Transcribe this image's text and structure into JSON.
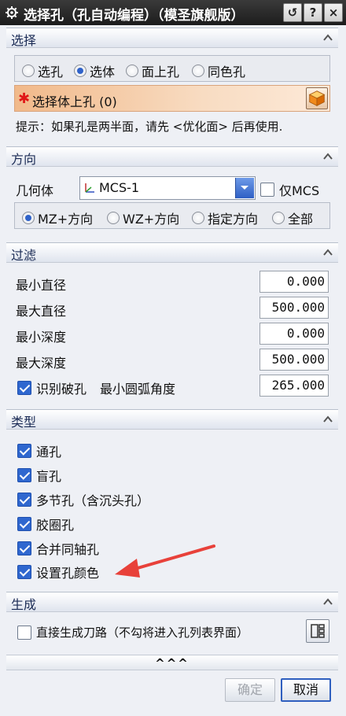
{
  "window": {
    "title": "选择孔（孔自动编程）（模圣旗舰版）",
    "title_buttons": [
      {
        "icon": "undo-icon",
        "label": "↺"
      },
      {
        "icon": "help-icon",
        "label": "?"
      },
      {
        "icon": "close-icon",
        "label": "×"
      }
    ]
  },
  "select_section": {
    "title": "选择",
    "modes": [
      {
        "label": "选孔",
        "selected": false
      },
      {
        "label": "选体",
        "selected": true
      },
      {
        "label": "面上孔",
        "selected": false
      },
      {
        "label": "同色孔",
        "selected": false
      }
    ],
    "select_label": "选择体上孔 (0)",
    "hint": "提示：如果孔是两半面，请先 <优化面> 后再使用."
  },
  "direction_section": {
    "title": "方向",
    "geometry_label": "几何体",
    "geometry_value": "MCS-1",
    "only_mcs_label": "仅MCS",
    "only_mcs_checked": false,
    "directions": [
      {
        "label": "MZ+方向",
        "selected": true
      },
      {
        "label": "WZ+方向",
        "selected": false
      },
      {
        "label": "指定方向",
        "selected": false
      },
      {
        "label": "全部",
        "selected": false
      }
    ]
  },
  "filter_section": {
    "title": "过滤",
    "min_diameter_label": "最小直径",
    "min_diameter": "0.000",
    "max_diameter_label": "最大直径",
    "max_diameter": "500.000",
    "min_depth_label": "最小深度",
    "min_depth": "0.000",
    "max_depth_label": "最大深度",
    "max_depth": "500.000",
    "broken_hole_label": "识别破孔",
    "broken_hole_checked": true,
    "min_arc_angle_label": "最小圆弧角度",
    "min_arc_angle": "265.000"
  },
  "type_section": {
    "title": "类型",
    "items": [
      {
        "label": "通孔",
        "checked": true
      },
      {
        "label": "盲孔",
        "checked": true
      },
      {
        "label": "多节孔（含沉头孔）",
        "checked": true
      },
      {
        "label": "胶圈孔",
        "checked": true
      },
      {
        "label": "合并同轴孔",
        "checked": true
      },
      {
        "label": "设置孔颜色",
        "checked": true
      }
    ]
  },
  "generate_section": {
    "title": "生成",
    "direct_toolpath_label": "直接生成刀路（不勾将进入孔列表界面）",
    "direct_toolpath_checked": false
  },
  "footer": {
    "more_label": "^^^",
    "ok_label": "确定",
    "ok_enabled": false,
    "cancel_label": "取消"
  },
  "colors": {
    "title_bar": "#262626",
    "section_title": "#1b2b55",
    "required_star": "#e01818",
    "selection_bar": "#f1b98a",
    "checkbox_checked": "#2f67cf",
    "annotation_arrow": "#e8413a"
  }
}
